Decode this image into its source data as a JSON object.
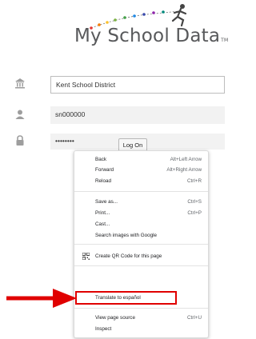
{
  "logo": {
    "title": "My School Data",
    "tm": "TM"
  },
  "form": {
    "district": "Kent School District",
    "username": "sn000000",
    "password": "••••••••",
    "logon_label": "Log On"
  },
  "context_menu": {
    "back": {
      "label": "Back",
      "shortcut": "Alt+Left Arrow"
    },
    "forward": {
      "label": "Forward",
      "shortcut": "Alt+Right Arrow"
    },
    "reload": {
      "label": "Reload",
      "shortcut": "Ctrl+R"
    },
    "save_as": {
      "label": "Save as...",
      "shortcut": "Ctrl+S"
    },
    "print": {
      "label": "Print...",
      "shortcut": "Ctrl+P"
    },
    "cast": {
      "label": "Cast..."
    },
    "search_images": {
      "label": "Search images with Google"
    },
    "qr_code": {
      "label": "Create QR Code for this page"
    },
    "translate": {
      "label": "Translate to español"
    },
    "view_source": {
      "label": "View page source",
      "shortcut": "Ctrl+U"
    },
    "inspect": {
      "label": "Inspect"
    }
  },
  "colors": {
    "highlight": "#e00000",
    "arrow": "#e00000",
    "menu_text": "#202124"
  },
  "icons": [
    "school-building-icon",
    "user-icon",
    "lock-icon",
    "qr-code-icon",
    "arrow-right-icon"
  ]
}
